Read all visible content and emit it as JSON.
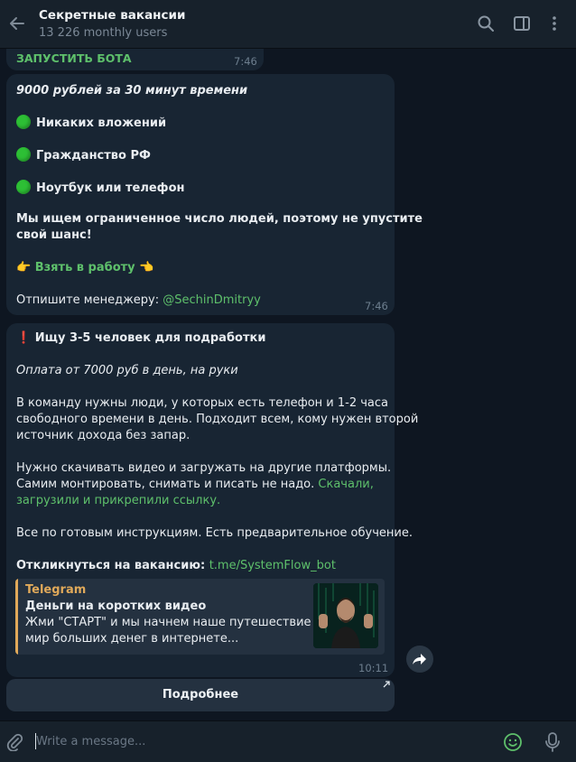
{
  "header": {
    "title": "Секретные вакансии",
    "subtitle": "13 226 monthly users"
  },
  "msg1": {
    "link": "ЗАПУСТИТЬ БОТА",
    "time": "7:46"
  },
  "msg2": {
    "line1": "9000 рублей за 30 минут времени",
    "item1": "Никаких вложений",
    "item2": "Гражданство РФ",
    "item3": "Ноутбук или телефон",
    "para1": "Мы ищем ограниченное число людей, поэтому не упустите",
    "para2": "свой шанс!",
    "cta_left": "👉",
    "cta": "Взять в работу",
    "cta_right": "👈",
    "manager_label": "Отпишите менеджеру: ",
    "manager": "@SechinDmitryy",
    "time": "7:46"
  },
  "msg3": {
    "heading_mark": "❗",
    "heading": "Ищу 3-5 человек для подработки",
    "pay": "Оплата от 7000 руб в день, на руки",
    "p1a": "В команду нужны люди, у которых есть телефон и 1-2 часа",
    "p1b": "свободного времени в день. Подходит всем, кому нужен второй",
    "p1c": "источник дохода без запар.",
    "p2a": "Нужно скачивать видео и загружать на другие платформы.",
    "p2b": "Самим монтировать, снимать и писать не надо. ",
    "p2b_link": "Скачали,",
    "p2c_link": "загрузили и прикрепили ссылку.",
    "p3": "Все по готовым инструкциям. Есть предварительное обучение.",
    "respond_label": "Откликнуться на вакансию: ",
    "respond_link": "t.me/SystemFlow_bot",
    "preview": {
      "site": "Telegram",
      "title": "Деньги на коротких видео",
      "desc1": "Жми \"СТАРТ\" и мы начнем наше путешествие в",
      "desc2": "мир больших денег в интернете..."
    },
    "time": "10:11",
    "button": "Подробнее"
  },
  "input": {
    "placeholder": "Write a message..."
  },
  "colors": {
    "accent": "#5ec06b",
    "bubble": "#182533",
    "background": "#0e1621",
    "preview_bar": "#e0a95a"
  },
  "icons": [
    "back-arrow-icon",
    "search-icon",
    "sidebar-toggle-icon",
    "more-vertical-icon",
    "share-icon",
    "external-link-icon",
    "attach-icon",
    "emoji-icon",
    "microphone-icon"
  ]
}
